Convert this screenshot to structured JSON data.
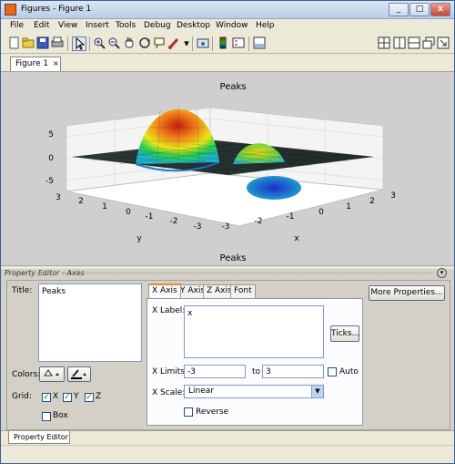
{
  "window": {
    "title": "Figures - Figure 1",
    "min_label": "_",
    "max_label": "□",
    "close_label": "x"
  },
  "menu": [
    "File",
    "Edit",
    "View",
    "Insert",
    "Tools",
    "Debug",
    "Desktop",
    "Window",
    "Help"
  ],
  "toolbar": {
    "icons": [
      "new-file",
      "open-file",
      "save",
      "print",
      "select-arrow",
      "zoom-in",
      "zoom-out",
      "pan",
      "rotate-3d",
      "data-cursor",
      "brush",
      "link",
      "insert-colorbar",
      "insert-legend",
      "show-plot-tools"
    ],
    "layout_icons": [
      "tile-icon",
      "split-horizontal-icon",
      "split-vertical-icon",
      "float-icon",
      "dock-icon"
    ]
  },
  "doc_tab": {
    "label": "Figure 1",
    "close": "×"
  },
  "plot": {
    "title": "Peaks",
    "z_ticks": [
      "5",
      "0",
      "-5"
    ],
    "y_ticks": [
      "3",
      "2",
      "1",
      "0",
      "-1",
      "-2",
      "-3"
    ],
    "x_ticks": [
      "-3",
      "-2",
      "-1",
      "0",
      "1",
      "2",
      "3"
    ],
    "xlabel": "x",
    "ylabel": "y",
    "bottom_title": "Peaks"
  },
  "property_editor": {
    "header": "Property Editor - Axes",
    "title_label": "Title:",
    "title_value": "Peaks",
    "colors_label": "Colors:",
    "grid_label": "Grid:",
    "grid": [
      {
        "label": "X",
        "checked": true
      },
      {
        "label": "Y",
        "checked": true
      },
      {
        "label": "Z",
        "checked": true
      }
    ],
    "box_label": "Box",
    "tabs": [
      "X Axis",
      "Y Axis",
      "Z Axis",
      "Font"
    ],
    "more_properties": "More Properties...",
    "x_label_label": "X Label:",
    "x_label_value": "x",
    "ticks_button": "Ticks...",
    "x_limits_label": "X Limits:",
    "x_limit_min": "-3",
    "to_label": "to",
    "x_limit_max": "3",
    "auto_label": "Auto",
    "x_scale_label": "X Scale:",
    "x_scale_value": "Linear",
    "reverse_label": "Reverse",
    "check_mark": "✓"
  },
  "bottom_tab": "Property Editor",
  "colors": {
    "surface_high": "#c81e0a",
    "surface_mid": "#2ad050",
    "surface_low": "#1a2fc8"
  }
}
